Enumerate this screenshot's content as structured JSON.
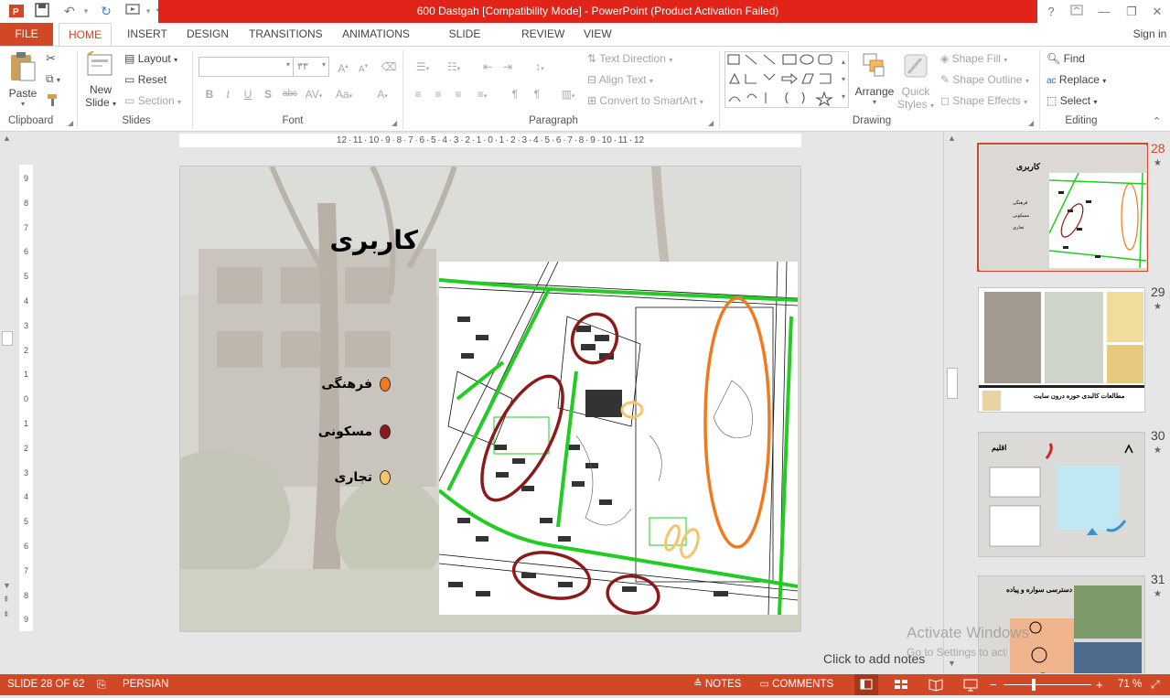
{
  "window": {
    "title": "600 Dastgah [Compatibility Mode] -  PowerPoint (Product Activation Failed)",
    "help": "?",
    "sign_in": "Sign in"
  },
  "tabs": [
    "FILE",
    "HOME",
    "INSERT",
    "DESIGN",
    "TRANSITIONS",
    "ANIMATIONS",
    "SLIDE SHOW",
    "REVIEW",
    "VIEW"
  ],
  "ribbon": {
    "clipboard": {
      "paste": "Paste",
      "label": "Clipboard"
    },
    "slides": {
      "new_slide_1": "New",
      "new_slide_2": "Slide",
      "layout": "Layout",
      "reset": "Reset",
      "section": "Section",
      "label": "Slides"
    },
    "font": {
      "size": "۳۳",
      "bold": "B",
      "italic": "I",
      "underline": "U",
      "shadow": "S",
      "strike": "abc",
      "spacing": "AV",
      "case": "Aa",
      "color": "A",
      "label": "Font"
    },
    "paragraph": {
      "text_direction": "Text Direction",
      "align_text": "Align Text",
      "convert": "Convert to SmartArt",
      "label": "Paragraph"
    },
    "drawing": {
      "arrange": "Arrange",
      "quick_1": "Quick",
      "quick_2": "Styles",
      "fill": "Shape Fill",
      "outline": "Shape Outline",
      "effects": "Shape Effects",
      "label": "Drawing"
    },
    "editing": {
      "find": "Find",
      "replace": "Replace",
      "select": "Select",
      "label": "Editing"
    }
  },
  "ruler": "12 · 11 · 10 · 9 · 8 · 7 · 6 · 5 · 4 · 3 · 2 · 1 · 0 · 1 · 2 · 3 · 4 · 5 · 6 · 7 · 8 · 9 · 10 · 11 · 12",
  "ruler_v": [
    "9",
    "8",
    "7",
    "6",
    "5",
    "4",
    "3",
    "2",
    "1",
    "0",
    "1",
    "2",
    "3",
    "4",
    "5",
    "6",
    "7",
    "8",
    "9"
  ],
  "slide": {
    "title": "كاربری",
    "legend": [
      {
        "label": "فرهنگی",
        "color": "#f07a1e"
      },
      {
        "label": "مسکونی",
        "color": "#8b1a1a"
      },
      {
        "label": "تجاری",
        "color": "#f6c46a"
      }
    ]
  },
  "notes": {
    "placeholder": "Click to add notes",
    "watermark_1": "Activate Windows",
    "watermark_2": "Go to Settings to activate Windows."
  },
  "thumbnails": [
    {
      "num": "28",
      "title": "كاربری",
      "legend": [
        "فرهنگی",
        "مسکونی",
        "تجاری"
      ],
      "selected": true
    },
    {
      "num": "29",
      "caption": "مطالعات کالبدی حوزه درون سایت"
    },
    {
      "num": "30",
      "title": "اقلیم"
    },
    {
      "num": "31",
      "title": "دسترسی سواره و پیاده"
    }
  ],
  "status": {
    "slide": "SLIDE 28 OF 62",
    "language": "PERSIAN",
    "notes": "NOTES",
    "comments": "COMMENTS",
    "zoom": "71 %"
  },
  "colors": {
    "accent": "#d24726",
    "title_bar": "#e0241a"
  }
}
